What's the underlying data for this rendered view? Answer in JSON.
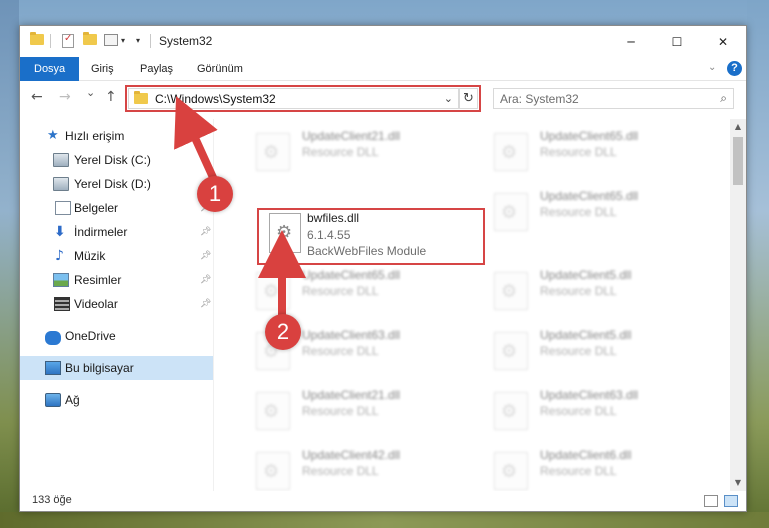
{
  "window": {
    "title": "System32",
    "controls": {
      "minimize": "─",
      "maximize": "☐",
      "close": "✕"
    }
  },
  "ribbon": {
    "tabs": [
      {
        "label": "Dosya",
        "active": true
      },
      {
        "label": "Giriş"
      },
      {
        "label": "Paylaş"
      },
      {
        "label": "Görünüm"
      }
    ],
    "help": "?"
  },
  "nav": {
    "back": "←",
    "forward": "→",
    "recent": "⌄",
    "up": "↑",
    "address": "C:\\Windows\\System32",
    "refresh": "↻",
    "search_placeholder": "Ara: System32"
  },
  "sidebar": {
    "items": [
      {
        "label": "Hızlı erişim",
        "icon": "star-icon"
      },
      {
        "label": "Yerel Disk (C:)",
        "icon": "disk-icon"
      },
      {
        "label": "Yerel Disk (D:)",
        "icon": "disk-icon"
      },
      {
        "label": "Belgeler",
        "icon": "documents-icon",
        "pinned": true
      },
      {
        "label": "İndirmeler",
        "icon": "download-icon",
        "pinned": true
      },
      {
        "label": "Müzik",
        "icon": "music-icon",
        "pinned": true
      },
      {
        "label": "Resimler",
        "icon": "pictures-icon",
        "pinned": true
      },
      {
        "label": "Videolar",
        "icon": "video-icon",
        "pinned": true
      },
      {
        "label": "OneDrive",
        "icon": "cloud-icon"
      },
      {
        "label": "Bu bilgisayar",
        "icon": "computer-icon",
        "selected": true
      },
      {
        "label": "Ağ",
        "icon": "network-icon"
      }
    ]
  },
  "files": {
    "left_column": [
      {
        "name": "UpdateClient21.dll",
        "desc": "Resource DLL"
      },
      {
        "name": "bwfiles.dll",
        "version": "6.1.4.55",
        "desc": "BackWebFiles Module",
        "highlighted": true
      },
      {
        "name": "UpdateClient65.dll",
        "desc": "Resource DLL"
      },
      {
        "name": "UpdateClient63.dll",
        "desc": "Resource DLL"
      },
      {
        "name": "UpdateClient21.dll",
        "desc": "Resource DLL"
      },
      {
        "name": "UpdateClient42.dll",
        "desc": "Resource DLL"
      }
    ],
    "right_column": [
      {
        "name": "UpdateClient65.dll",
        "desc": "Resource DLL"
      },
      {
        "name": "UpdateClient65.dll",
        "desc": "Resource DLL"
      },
      {
        "name": "UpdateClient5.dll",
        "desc": "Resource DLL"
      },
      {
        "name": "UpdateClient5.dll",
        "desc": "Resource DLL"
      },
      {
        "name": "UpdateClient63.dll",
        "desc": "Resource DLL"
      },
      {
        "name": "UpdateClient6.dll",
        "desc": "Resource DLL"
      }
    ]
  },
  "status": {
    "count": "133 öğe"
  },
  "annotations": {
    "step1": "1",
    "step2": "2",
    "color": "#d9413f"
  }
}
